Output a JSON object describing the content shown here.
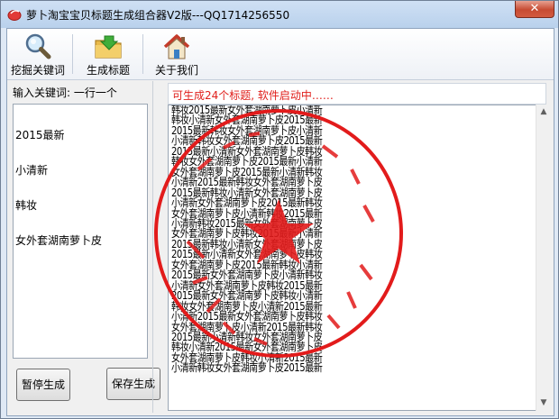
{
  "window": {
    "title": "萝卜淘宝宝贝标题生成组合器V2版---QQ1714256550",
    "close_label": "✕"
  },
  "toolbar": {
    "items": [
      {
        "label": "挖掘关键词",
        "icon": "magnifier-icon"
      },
      {
        "label": "生成标题",
        "icon": "folder-arrow-icon"
      },
      {
        "label": "关于我们",
        "icon": "home-icon"
      }
    ]
  },
  "left_panel": {
    "label": "输入关键词: 一行一个",
    "keywords": [
      "2015最新",
      "小清新",
      "韩妆",
      "女外套湖南萝卜皮"
    ],
    "pause_button": "暂停生成",
    "save_button": "保存生成"
  },
  "right_panel": {
    "status": "可生成24个标题, 软件启动中……",
    "results": [
      "韩妆2015最新女外套湖南萝卜皮小清新",
      "韩妆小清新女外套湖南萝卜皮2015最新",
      "2015最新韩妆女外套湖南萝卜皮小清新",
      "小清新韩妆女外套湖南萝卜皮2015最新",
      "2015最新小清新女外套湖南萝卜皮韩妆",
      "韩妆女外套湖南萝卜皮2015最新小清新",
      "女外套湖南萝卜皮2015最新小清新韩妆",
      "小清新2015最新韩妆女外套湖南萝卜皮",
      "2015最新韩妆小清新女外套湖南萝卜皮",
      "小清新女外套湖南萝卜皮2015最新韩妆",
      "女外套湖南萝卜皮小清新韩妆2015最新",
      "小清新韩妆2015最新女外套湖南萝卜皮",
      "女外套湖南萝卜皮韩妆2015最新小清新",
      "2015最新韩妆小清新女外套湖南萝卜皮",
      "2015最新小清新女外套湖南萝卜皮韩妆",
      "女外套湖南萝卜皮2015最新韩妆小清新",
      "2015最新女外套湖南萝卜皮小清新韩妆",
      "小清新女外套湖南萝卜皮韩妆2015最新",
      "2015最新女外套湖南萝卜皮韩妆小清新",
      "韩妆女外套湖南萝卜皮小清新2015最新",
      "小清新2015最新女外套湖南萝卜皮韩妆",
      "女外套湖南萝卜皮小清新2015最新韩妆",
      "2015最新小清新韩妆女外套湖南萝卜皮",
      "韩妆小清新2015最新女外套湖南萝卜皮",
      "女外套湖南萝卜皮韩妆小清新2015最新",
      "小清新韩妆女外套湖南萝卜皮2015最新"
    ]
  },
  "colors": {
    "status_text": "#e0201c",
    "seal_red": "#e21b1b",
    "title_gradient": "#cfe0f4"
  }
}
